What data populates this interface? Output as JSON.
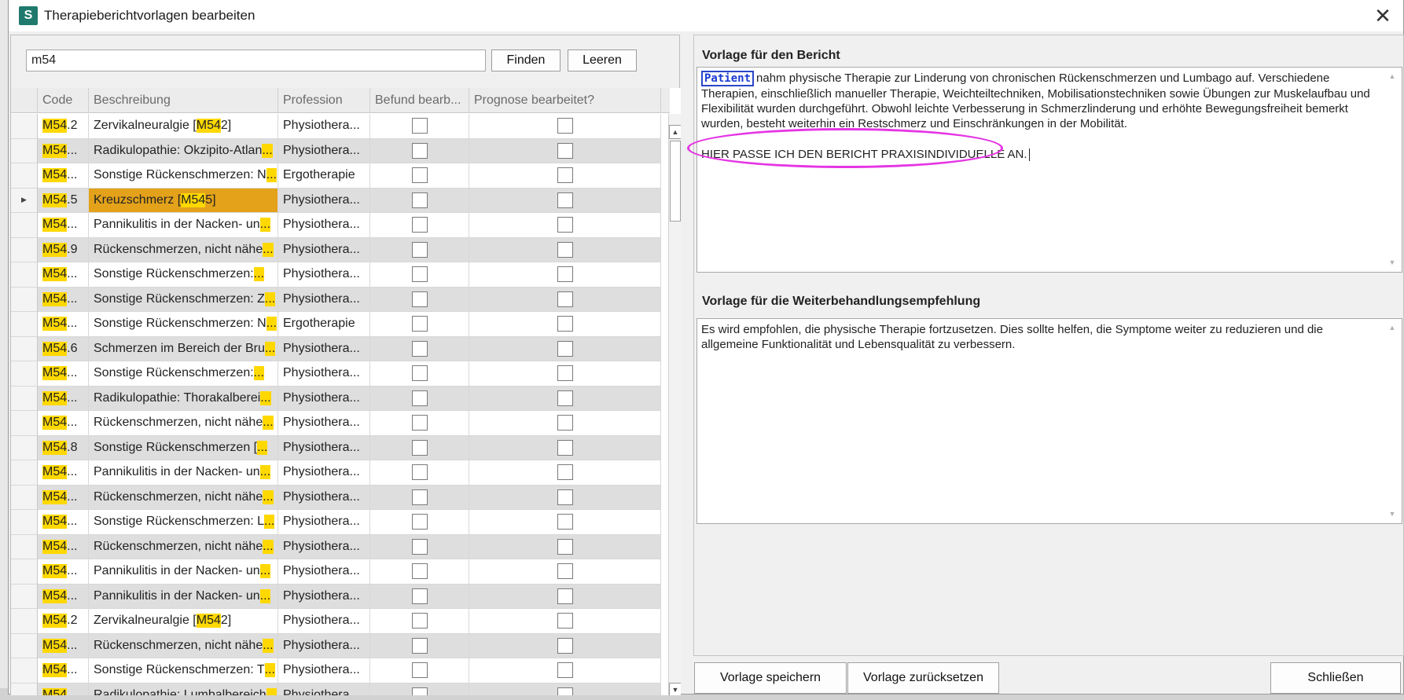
{
  "window": {
    "title": "Therapieberichtvorlagen bearbeiten",
    "app_icon_letter": "S",
    "close_glyph": "✕"
  },
  "search": {
    "value": "m54",
    "find_label": "Finden",
    "clear_label": "Leeren"
  },
  "grid": {
    "headers": {
      "code": "Code",
      "description": "Beschreibung",
      "profession": "Profession",
      "befund": "Befund bearb...",
      "prognose": "Prognose bearbeitet?"
    },
    "rows": [
      {
        "code_hl": "M54",
        "code_rest": ".2",
        "desc": "Zervikalneuralgie [",
        "desc_hl": "M54",
        "desc_tail": "2]",
        "desc_ell": false,
        "profession": "Physiothera...",
        "selected": false
      },
      {
        "code_hl": "M54",
        "code_rest": "...",
        "desc": "Radikulopathie: Okzipito-Atlan",
        "desc_hl": "",
        "desc_tail": "",
        "desc_ell": true,
        "profession": "Physiothera...",
        "selected": false
      },
      {
        "code_hl": "M54",
        "code_rest": "...",
        "desc": "Sonstige Rückenschmerzen: N",
        "desc_hl": "",
        "desc_tail": "",
        "desc_ell": true,
        "profession": "Ergotherapie",
        "selected": false
      },
      {
        "code_hl": "M54",
        "code_rest": ".5",
        "desc": "Kreuzschmerz [",
        "desc_hl": "M54",
        "desc_tail": "5]",
        "desc_ell": false,
        "profession": "Physiothera...",
        "selected": true
      },
      {
        "code_hl": "M54",
        "code_rest": "...",
        "desc": "Pannikulitis in der Nacken- un",
        "desc_hl": "",
        "desc_tail": "",
        "desc_ell": true,
        "profession": "Physiothera...",
        "selected": false
      },
      {
        "code_hl": "M54",
        "code_rest": ".9",
        "desc": "Rückenschmerzen, nicht nähe",
        "desc_hl": "",
        "desc_tail": "",
        "desc_ell": true,
        "profession": "Physiothera...",
        "selected": false
      },
      {
        "code_hl": "M54",
        "code_rest": "...",
        "desc": "Sonstige Rückenschmerzen:",
        "desc_hl": "",
        "desc_tail": "",
        "desc_ell": true,
        "profession": "Physiothera...",
        "selected": false
      },
      {
        "code_hl": "M54",
        "code_rest": "...",
        "desc": "Sonstige Rückenschmerzen: Z",
        "desc_hl": "",
        "desc_tail": "",
        "desc_ell": true,
        "profession": "Physiothera...",
        "selected": false
      },
      {
        "code_hl": "M54",
        "code_rest": "...",
        "desc": "Sonstige Rückenschmerzen: N",
        "desc_hl": "",
        "desc_tail": "",
        "desc_ell": true,
        "profession": "Ergotherapie",
        "selected": false
      },
      {
        "code_hl": "M54",
        "code_rest": ".6",
        "desc": "Schmerzen im Bereich der Bru",
        "desc_hl": "",
        "desc_tail": "",
        "desc_ell": true,
        "profession": "Physiothera...",
        "selected": false
      },
      {
        "code_hl": "M54",
        "code_rest": "...",
        "desc": "Sonstige Rückenschmerzen:",
        "desc_hl": "",
        "desc_tail": "",
        "desc_ell": true,
        "profession": "Physiothera...",
        "selected": false
      },
      {
        "code_hl": "M54",
        "code_rest": "...",
        "desc": "Radikulopathie: Thorakalberei",
        "desc_hl": "",
        "desc_tail": "",
        "desc_ell": true,
        "profession": "Physiothera...",
        "selected": false
      },
      {
        "code_hl": "M54",
        "code_rest": "...",
        "desc": "Rückenschmerzen, nicht nähe",
        "desc_hl": "",
        "desc_tail": "",
        "desc_ell": true,
        "profession": "Physiothera...",
        "selected": false
      },
      {
        "code_hl": "M54",
        "code_rest": ".8",
        "desc": "Sonstige Rückenschmerzen [",
        "desc_hl": "",
        "desc_tail": "",
        "desc_ell": true,
        "profession": "Physiothera...",
        "selected": false
      },
      {
        "code_hl": "M54",
        "code_rest": "...",
        "desc": "Pannikulitis in der Nacken- un",
        "desc_hl": "",
        "desc_tail": "",
        "desc_ell": true,
        "profession": "Physiothera...",
        "selected": false
      },
      {
        "code_hl": "M54",
        "code_rest": "...",
        "desc": "Rückenschmerzen, nicht nähe",
        "desc_hl": "",
        "desc_tail": "",
        "desc_ell": true,
        "profession": "Physiothera...",
        "selected": false
      },
      {
        "code_hl": "M54",
        "code_rest": "...",
        "desc": "Sonstige Rückenschmerzen: L",
        "desc_hl": "",
        "desc_tail": "",
        "desc_ell": true,
        "profession": "Physiothera...",
        "selected": false
      },
      {
        "code_hl": "M54",
        "code_rest": "...",
        "desc": "Rückenschmerzen, nicht nähe",
        "desc_hl": "",
        "desc_tail": "",
        "desc_ell": true,
        "profession": "Physiothera...",
        "selected": false
      },
      {
        "code_hl": "M54",
        "code_rest": "...",
        "desc": "Pannikulitis in der Nacken- un",
        "desc_hl": "",
        "desc_tail": "",
        "desc_ell": true,
        "profession": "Physiothera...",
        "selected": false
      },
      {
        "code_hl": "M54",
        "code_rest": "...",
        "desc": "Pannikulitis in der Nacken- un",
        "desc_hl": "",
        "desc_tail": "",
        "desc_ell": true,
        "profession": "Physiothera...",
        "selected": false
      },
      {
        "code_hl": "M54",
        "code_rest": ".2",
        "desc": "Zervikalneuralgie [",
        "desc_hl": "M54",
        "desc_tail": "2]",
        "desc_ell": false,
        "profession": "Physiothera...",
        "selected": false
      },
      {
        "code_hl": "M54",
        "code_rest": "...",
        "desc": "Rückenschmerzen, nicht nähe",
        "desc_hl": "",
        "desc_tail": "",
        "desc_ell": true,
        "profession": "Physiothera...",
        "selected": false
      },
      {
        "code_hl": "M54",
        "code_rest": "...",
        "desc": "Sonstige Rückenschmerzen: T",
        "desc_hl": "",
        "desc_tail": "",
        "desc_ell": true,
        "profession": "Physiothera...",
        "selected": false
      },
      {
        "code_hl": "M54",
        "code_rest": "...",
        "desc": "Radikulopathie: Lumbalbereich",
        "desc_hl": "",
        "desc_tail": "",
        "desc_ell": true,
        "profession": "Physiothera...",
        "selected": false
      }
    ],
    "colors": {
      "match_highlight": "#ffd800",
      "selected_cell": "#e3a21a",
      "alt_row": "#dedede"
    }
  },
  "report": {
    "title": "Vorlage für den Bericht",
    "placeholder_tag": "Patient",
    "text": "nahm physische Therapie zur Linderung von chronischen Rückenschmerzen und Lumbago auf. Verschiedene Therapien, einschließlich manueller Therapie, Weichteiltechniken, Mobilisationstechniken sowie Übungen zur Muskelaufbau und Flexibilität wurden durchgeführt. Obwohl leichte Verbesserung in Schmerzlinderung und erhöhte Bewegungsfreiheit bemerkt wurden, besteht weiterhin ein Restschmerz und Einschränkungen in der Mobilität.",
    "custom_line": "HIER PASSE ICH DEN BERICHT PRAXISINDIVIDUELLE AN.",
    "annotation_color": "#e535e4"
  },
  "recommendation": {
    "title": "Vorlage für die Weiterbehandlungsempfehlung",
    "text": "Es wird empfohlen, die physische Therapie fortzusetzen. Dies sollte helfen, die Symptome weiter zu reduzieren und die allgemeine Funktionalität und Lebensqualität zu verbessern."
  },
  "footer": {
    "save_label": "Vorlage speichern",
    "reset_label": "Vorlage zurücksetzen",
    "close_label": "Schließen"
  }
}
